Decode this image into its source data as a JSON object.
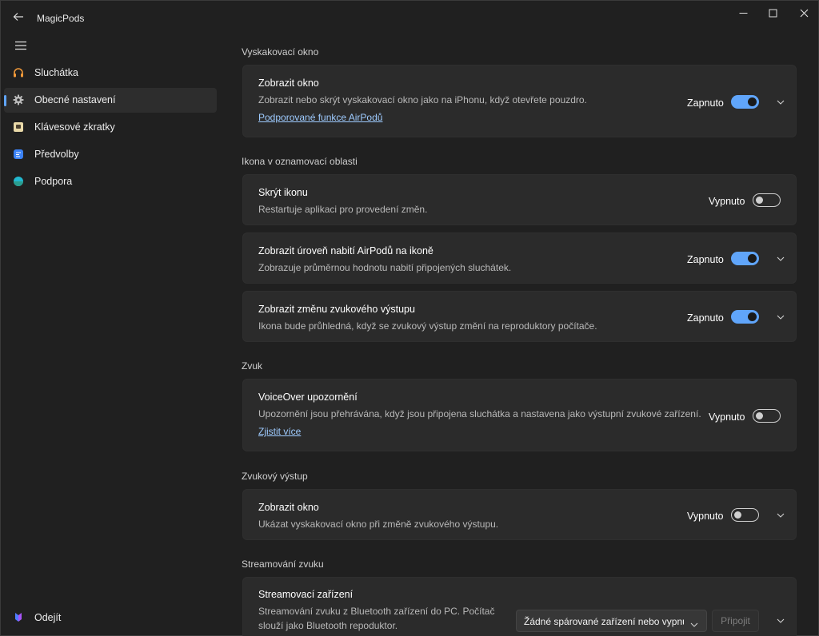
{
  "app": {
    "title": "MagicPods"
  },
  "sidebar": {
    "items": [
      {
        "label": "Sluchátka"
      },
      {
        "label": "Obecné nastavení"
      },
      {
        "label": "Klávesové zkratky"
      },
      {
        "label": "Předvolby"
      },
      {
        "label": "Podpora"
      }
    ],
    "exit_label": "Odejít"
  },
  "sections": {
    "popup": {
      "heading": "Vyskakovací okno",
      "show_window": {
        "title": "Zobrazit okno",
        "description": "Zobrazit nebo skrýt vyskakovací okno jako na iPhonu, když otevřete pouzdro.",
        "link": "Podporované funkce AirPodů",
        "state": "Zapnuto"
      }
    },
    "tray": {
      "heading": "Ikona v oznamovací oblasti",
      "hide_icon": {
        "title": "Skrýt ikonu",
        "description": "Restartuje aplikaci pro provedení změn.",
        "state": "Vypnuto"
      },
      "battery_level": {
        "title": "Zobrazit úroveň nabití AirPodů na ikoně",
        "description": "Zobrazuje průměrnou hodnotu nabití připojených sluchátek.",
        "state": "Zapnuto"
      },
      "output_change": {
        "title": "Zobrazit změnu zvukového výstupu",
        "description": "Ikona bude průhledná, když se zvukový výstup změní na reproduktory počítače.",
        "state": "Zapnuto"
      }
    },
    "sound": {
      "heading": "Zvuk",
      "voiceover": {
        "title": "VoiceOver upozornění",
        "description": "Upozornění jsou přehrávána, když jsou připojena sluchátka a nastavena jako výstupní zvukové zařízení.",
        "link": "Zjistit více",
        "state": "Vypnuto"
      }
    },
    "output": {
      "heading": "Zvukový výstup",
      "show_window": {
        "title": "Zobrazit okno",
        "description": "Ukázat vyskakovací okno při změně zvukového výstupu.",
        "state": "Vypnuto"
      }
    },
    "streaming": {
      "heading": "Streamování zvuku",
      "device": {
        "title": "Streamovací zařízení",
        "description_line1": "Streamování zvuku z Bluetooth zařízení do PC. Počítač",
        "description_line2": "slouží jako Bluetooth repoduktor.",
        "dropdown_value": "Žádné spárované zařízení nebo vypnuto",
        "connect_label": "Připojit"
      }
    }
  },
  "colors": {
    "accent": "#60a5fa",
    "background": "#202020",
    "card": "#2b2b2b"
  }
}
